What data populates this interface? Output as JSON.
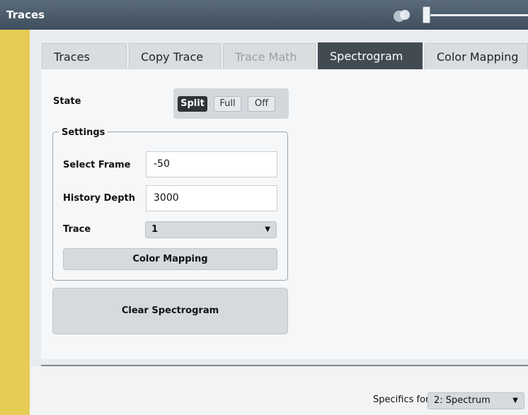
{
  "window": {
    "title": "Traces"
  },
  "tabs": [
    {
      "label": "Traces",
      "state": "normal"
    },
    {
      "label": "Copy Trace",
      "state": "normal"
    },
    {
      "label": "Trace Math",
      "state": "disabled"
    },
    {
      "label": "Spectrogram",
      "state": "active"
    },
    {
      "label": "Color Mapping",
      "state": "normal"
    }
  ],
  "state": {
    "label": "State",
    "options": [
      "Split",
      "Full",
      "Off"
    ],
    "selected": "Split"
  },
  "settings": {
    "legend": "Settings",
    "select_frame": {
      "label": "Select Frame",
      "value": "-50"
    },
    "history_depth": {
      "label": "History Depth",
      "value": "3000"
    },
    "trace": {
      "label": "Trace",
      "value": "1"
    },
    "color_mapping_button": "Color Mapping"
  },
  "clear_button": "Clear Spectrogram",
  "footer": {
    "label": "Specifics for",
    "value": "2: Spectrum"
  },
  "colors": {
    "accent_strip": "#e6cc55",
    "title_bar": "#4a5a6a",
    "active_tab": "#424a52"
  }
}
